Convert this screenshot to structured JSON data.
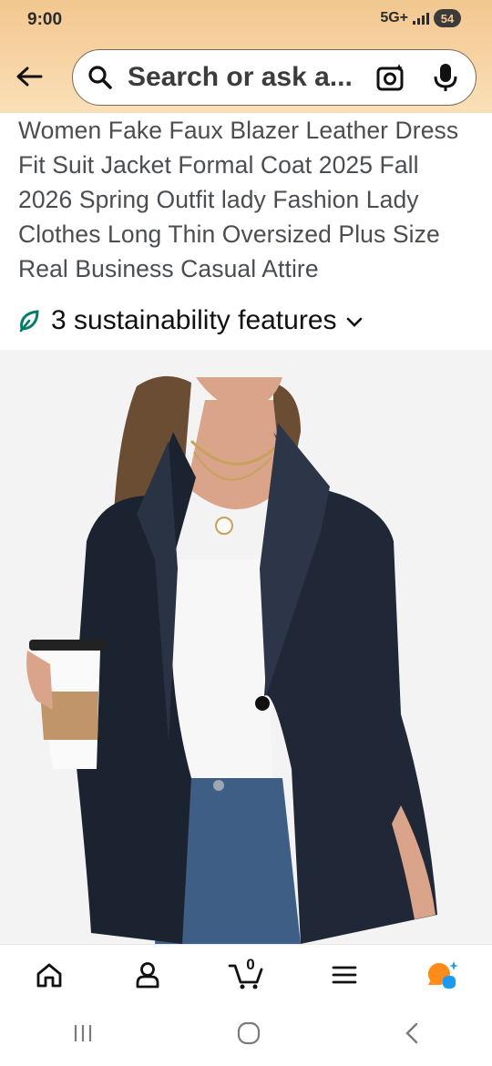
{
  "status": {
    "time": "9:00",
    "network": "5G+",
    "battery": "54"
  },
  "search": {
    "placeholder": "Search or ask a..."
  },
  "product": {
    "title": "Women Fake Faux Blazer Leather Dress Fit Suit Jacket Formal Coat 2025 Fall 2026 Spring Outfit lady Fashion Lady Clothes Long Thin Oversized Plus Size Real Business Casual Attire",
    "sustainability": "3 sustainability features"
  },
  "bottom_nav": {
    "cart_count": "0",
    "items": [
      "home-icon",
      "account-icon",
      "cart-icon",
      "menu-icon",
      "rufus-ai-icon"
    ]
  },
  "colors": {
    "header_top": "#f2c790",
    "header_bottom": "#fae0b9",
    "sustain_green": "#067d62",
    "ai_orange": "#ff8c1a",
    "ai_blue": "#1a9bf0"
  }
}
